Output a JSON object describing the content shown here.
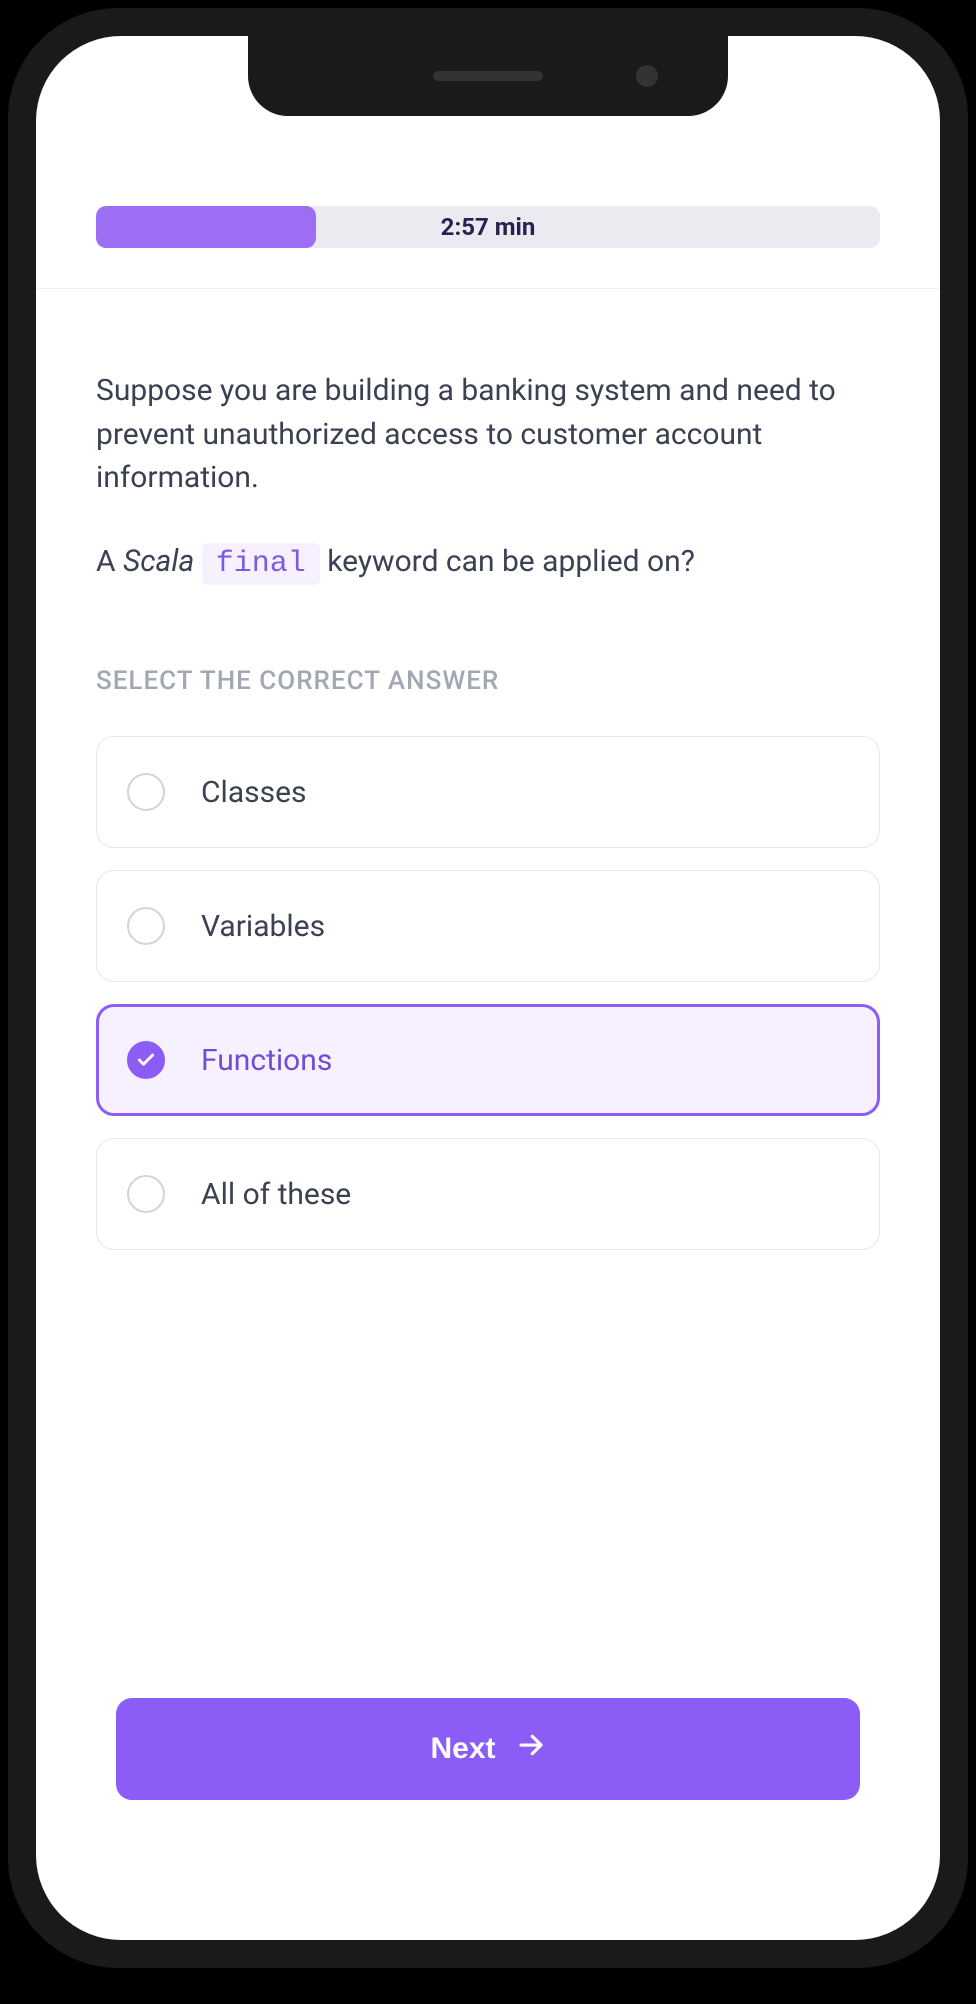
{
  "progress": {
    "percent": 28,
    "time_label": "2:57 min"
  },
  "question": {
    "context": "Suppose you are building a banking system and need to prevent unauthorized access to customer account information.",
    "prompt_prefix": "A ",
    "prompt_lang": "Scala",
    "prompt_code": "final",
    "prompt_suffix": " keyword can be applied on?"
  },
  "answers": {
    "label": "SELECT THE CORRECT ANSWER",
    "options": [
      {
        "label": "Classes",
        "selected": false
      },
      {
        "label": "Variables",
        "selected": false
      },
      {
        "label": "Functions",
        "selected": true
      },
      {
        "label": "All of these",
        "selected": false
      }
    ]
  },
  "footer": {
    "next_label": "Next"
  },
  "colors": {
    "accent": "#8b5cf6",
    "accent_light": "#9b6ef3",
    "option_bg_selected": "#f6f0ff"
  }
}
